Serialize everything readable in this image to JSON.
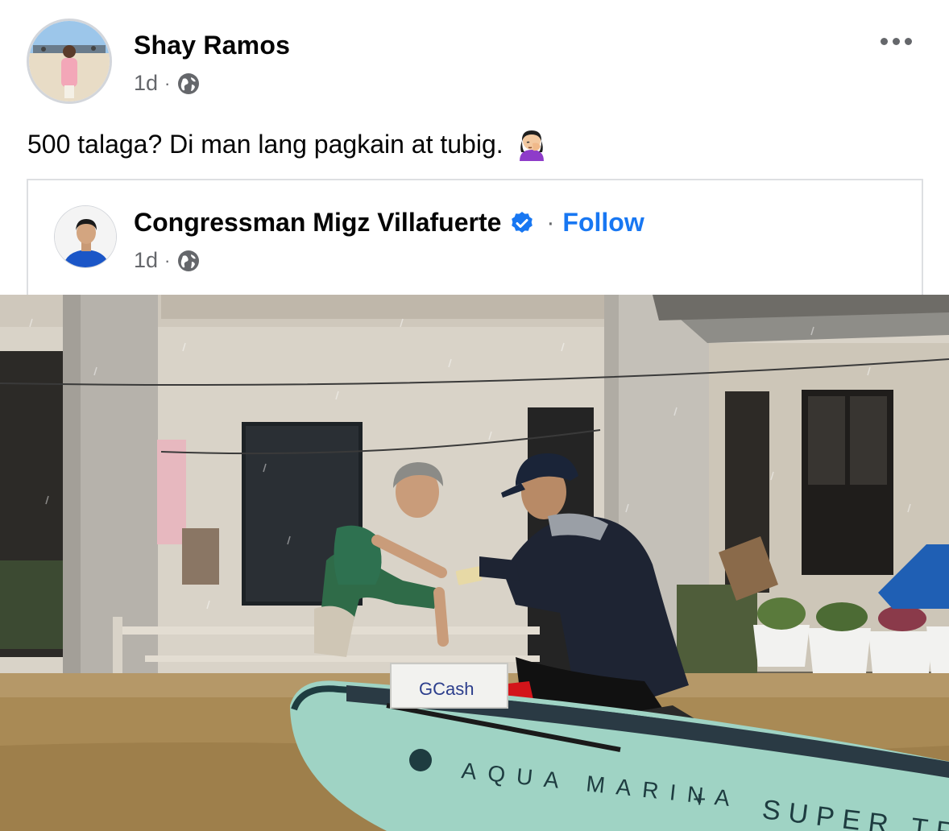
{
  "post": {
    "author": "Shay Ramos",
    "time": "1d",
    "separator": "·",
    "privacy_icon": "globe-icon",
    "caption": "500 talaga? Di man lang pagkain at tubig.",
    "caption_emoji": "woman-facepalming-emoji",
    "menu_icon": "more-horizontal-icon"
  },
  "shared": {
    "author": "Congressman Migz Villafuerte",
    "verified_icon": "verified-badge-icon",
    "separator": "·",
    "follow_label": "Follow",
    "time": "1d",
    "privacy_icon": "globe-icon"
  },
  "photo": {
    "board_text_1": "AQUA MARINA",
    "board_text_2": "SUPER TR",
    "box_text": "GCash"
  },
  "colors": {
    "link_blue": "#1877f2",
    "secondary_text": "#65676b",
    "verified_blue": "#1877f2",
    "flood_water": "#a98a55"
  }
}
